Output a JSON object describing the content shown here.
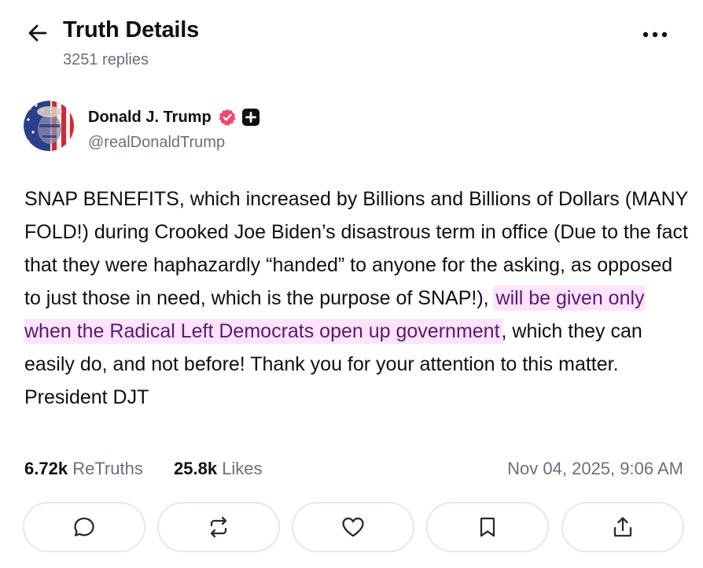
{
  "header": {
    "title": "Truth Details",
    "replies": "3251 replies",
    "back_icon": "arrow-left-icon",
    "more_icon": "more-horizontal-icon"
  },
  "author": {
    "display_name": "Donald J. Trump",
    "handle": "@realDonaldTrump",
    "verified_color": "#f2466e",
    "badge_icon": "plus-badge-icon"
  },
  "post": {
    "text_before": "SNAP BENEFITS, which increased by Billions and Billions of Dollars (MANY FOLD!) during Crooked Joe Biden’s disastrous term in office (Due to the fact that they were haphazardly “handed” to anyone for the asking, as opposed to just those in need, which is the purpose of SNAP!), ",
    "text_highlight": "will be given only when the Radical Left Democrats open up government",
    "text_after": ", which they can easily do, and not before! Thank you for your attention to this matter. President DJT",
    "highlight_color": "#fde3fb"
  },
  "stats": {
    "retruths_count": "6.72k",
    "retruths_label": "ReTruths",
    "likes_count": "25.8k",
    "likes_label": "Likes",
    "timestamp": "Nov 04, 2025, 9:06 AM"
  },
  "actions": [
    {
      "name": "reply",
      "icon": "speech-bubble-icon"
    },
    {
      "name": "retruth",
      "icon": "repost-icon"
    },
    {
      "name": "like",
      "icon": "heart-icon"
    },
    {
      "name": "bookmark",
      "icon": "bookmark-icon"
    },
    {
      "name": "share",
      "icon": "share-upload-icon"
    }
  ]
}
